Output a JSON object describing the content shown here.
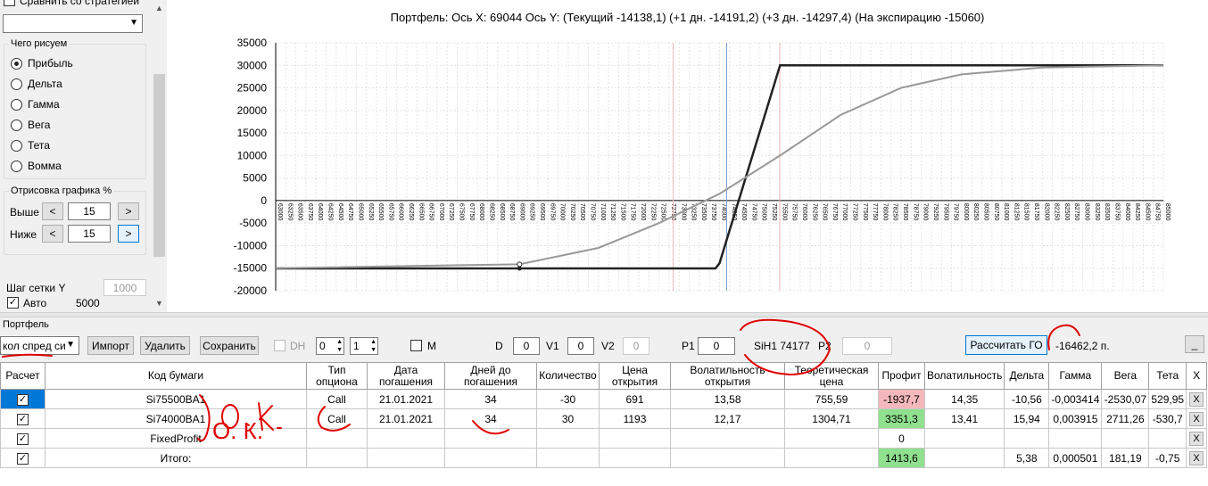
{
  "left_panel": {
    "compare_label": "Сравнить со стратегией",
    "draw_group_title": "Чего рисуем",
    "radio_options": [
      {
        "label": "Прибыль",
        "selected": true
      },
      {
        "label": "Дельта",
        "selected": false
      },
      {
        "label": "Гамма",
        "selected": false
      },
      {
        "label": "Вега",
        "selected": false
      },
      {
        "label": "Тета",
        "selected": false
      },
      {
        "label": "Вомма",
        "selected": false
      }
    ],
    "render_group_title": "Отрисовка графика %",
    "above_label": "Выше",
    "above_value": "15",
    "below_label": "Ниже",
    "below_value": "15",
    "left_arrow": "<",
    "right_arrow": ">",
    "grid_step_label": "Шаг сетки Y",
    "grid_step_value": "1000",
    "auto_label": "Авто",
    "auto_value": "5000"
  },
  "chart": {
    "title": "Портфель: Ось X: 69044 Ось Y:  (Текущий -14138,1)  (+1 дн. -14191,2)  (+3 дн. -14297,4)  (На экспирацию -15060)"
  },
  "chart_data": {
    "type": "line",
    "title": "Портфель: Ось X: 69044 Ось Y:  (Текущий -14138,1)  (+1 дн. -14191,2)  (+3 дн. -14297,4)  (На экспирацию -15060)",
    "xlim": [
      63000,
      85000
    ],
    "x_tick_step": 250,
    "ylim": [
      -20000,
      35000
    ],
    "y_ticks": [
      -20000,
      -15000,
      -10000,
      -5000,
      0,
      5000,
      10000,
      15000,
      20000,
      25000,
      30000,
      35000
    ],
    "grid": true,
    "series": [
      {
        "x": [
          63000,
          73900,
          74000,
          75500,
          85000
        ],
        "y": [
          -15060,
          -15060,
          -13900,
          30000,
          30000
        ],
        "color": "#222222"
      },
      {
        "x": [
          63000,
          69044,
          71000,
          72500,
          74000,
          75500,
          77000,
          78500,
          80000,
          82000,
          85000
        ],
        "y": [
          -15000,
          -14138,
          -10500,
          -5000,
          1500,
          10000,
          19000,
          25000,
          28000,
          29500,
          30000
        ],
        "color": "#999999"
      }
    ],
    "vlines": [
      {
        "x": 74177,
        "color": "#7f9fcf"
      },
      {
        "x": 72850,
        "color": "#f4b8bc"
      },
      {
        "x": 75490,
        "color": "#f4b8bc"
      }
    ]
  },
  "bottom": {
    "portfolio_label": "Портфель",
    "portfolio_select": "кол спред си",
    "import_label": "Импорт",
    "delete_label": "Удалить",
    "save_label": "Сохранить",
    "dh_label": "DH",
    "dh_spin1": "0",
    "dh_spin2": "1",
    "m_label": "M",
    "d_label": "D",
    "d_value": "0",
    "v1_label": "V1",
    "v1_value": "0",
    "v2_label": "V2",
    "v2_value": "0",
    "p1_label": "P1",
    "p1_value": "0",
    "instrument_label": "SiH1 74177",
    "p2_label": "P2",
    "p2_value": "0",
    "calc_go_label": "Рассчитать ГО",
    "go_value": "-16462,2 п.",
    "minimize_label": "_"
  },
  "table": {
    "headers": [
      "Расчет",
      "Код бумаги",
      "Тип опциона",
      "Дата погашения",
      "Дней до погашения",
      "Количество",
      "Цена открытия",
      "Волатильность открытия",
      "Теоретическая цена",
      "Профит",
      "Волатильность",
      "Дельта",
      "Гамма",
      "Вега",
      "Тета",
      "X"
    ],
    "rows": [
      {
        "code": "Si75500BA1",
        "type": "Call",
        "date": "21.01.2021",
        "days": "34",
        "qty": "-30",
        "price": "691",
        "vol_open": "13,58",
        "theo": "755,59",
        "profit": "-1937,7",
        "vol": "14,35",
        "delta": "-10,56",
        "gamma": "-0,003414",
        "vega": "-2530,07",
        "theta": "529,95",
        "x": "X"
      },
      {
        "code": "Si74000BA1",
        "type": "Call",
        "date": "21.01.2021",
        "days": "34",
        "qty": "30",
        "price": "1193",
        "vol_open": "12,17",
        "theo": "1304,71",
        "profit": "3351,3",
        "vol": "13,41",
        "delta": "15,94",
        "gamma": "0,003915",
        "vega": "2711,26",
        "theta": "-530,7",
        "x": "X"
      },
      {
        "code": "FixedProfit",
        "type": "",
        "date": "",
        "days": "",
        "qty": "",
        "price": "",
        "vol_open": "",
        "theo": "",
        "profit": "0",
        "vol": "",
        "delta": "",
        "gamma": "",
        "vega": "",
        "theta": "",
        "x": "X"
      },
      {
        "code": "Итого:",
        "type": "",
        "date": "",
        "days": "",
        "qty": "",
        "price": "",
        "vol_open": "",
        "theo": "",
        "profit": "1413,6",
        "vol": "",
        "delta": "5,38",
        "gamma": "0,000501",
        "vega": "181,19",
        "theta": "-0,75",
        "x": "X"
      }
    ]
  },
  "annotations": {
    "handwriting": "О. К.",
    "color": "#e00000"
  }
}
